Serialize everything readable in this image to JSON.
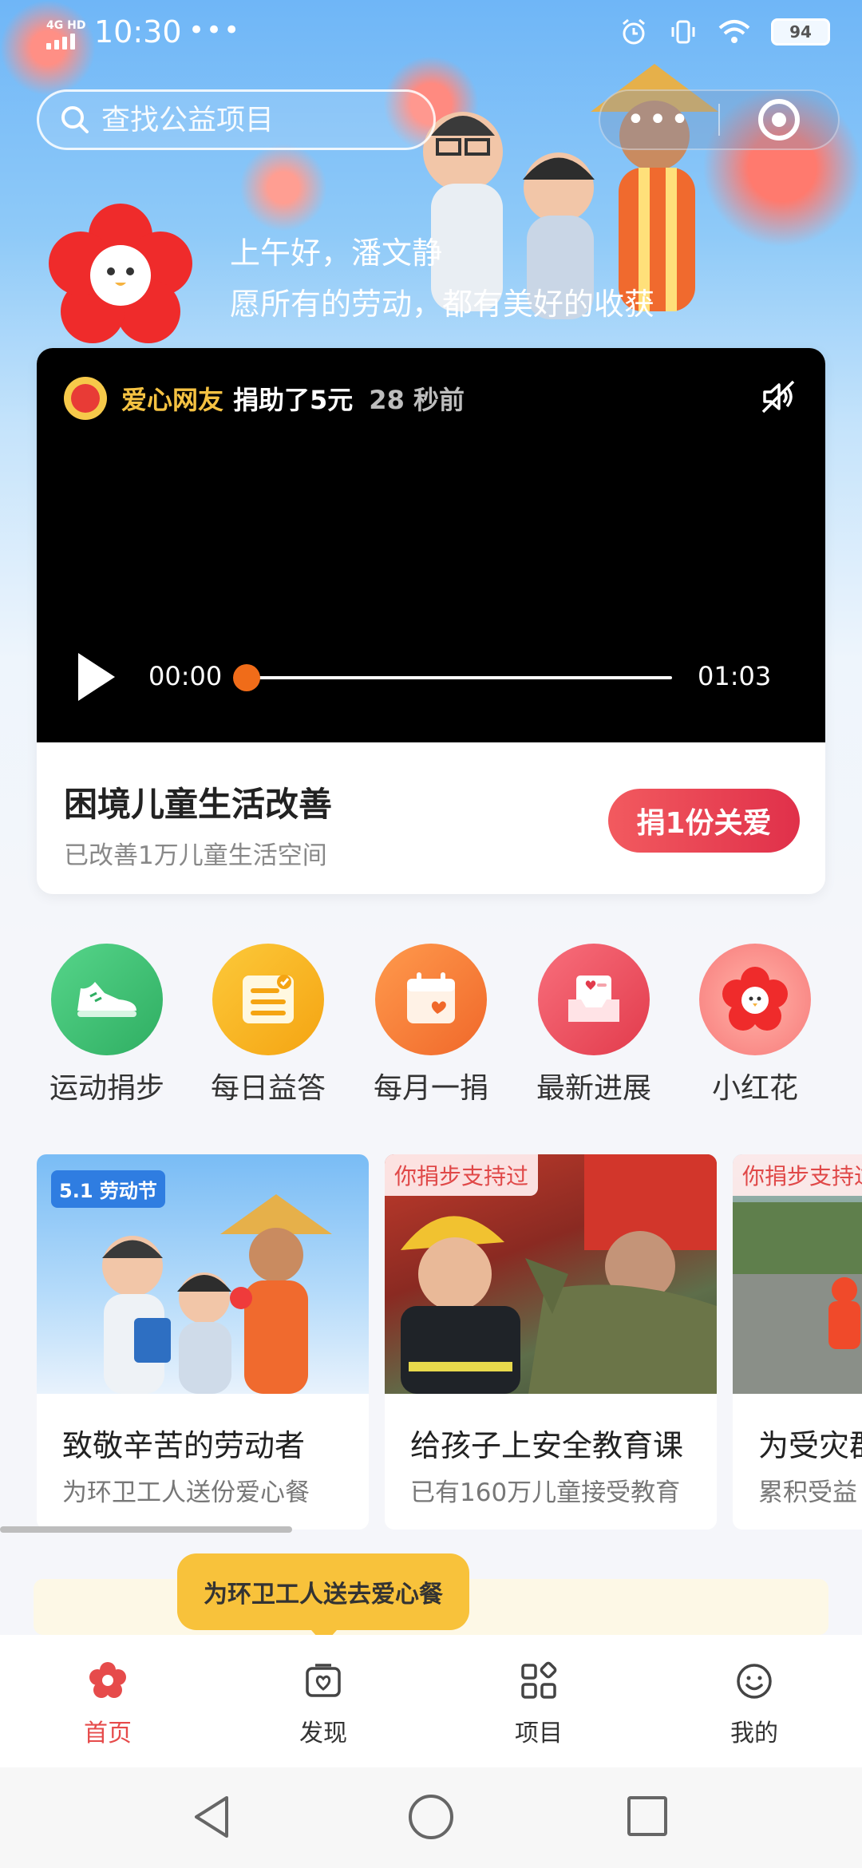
{
  "status_bar": {
    "network": "4G HD",
    "time": "10:30",
    "dots": "•••",
    "battery": "94"
  },
  "search": {
    "placeholder": "查找公益项目"
  },
  "capsule": {
    "more": "•••"
  },
  "greeting": {
    "line1": "上午好，潘文静",
    "line2": "愿所有的劳动，都有美好的收获"
  },
  "video_card": {
    "donor_name": "爱心网友",
    "donor_action": "捐助了5元",
    "donor_time": "28 秒前",
    "current_time": "00:00",
    "total_time": "01:03",
    "progress": 0,
    "project_title": "困境儿童生活改善",
    "project_subtitle": "已改善1万儿童生活空间",
    "donate_label": "捐1份关爱"
  },
  "quick_entries": [
    {
      "label": "运动捐步",
      "icon": "sneaker-icon",
      "color": "#3fbf72"
    },
    {
      "label": "每日益答",
      "icon": "quiz-card-icon",
      "color": "#f9b21f"
    },
    {
      "label": "每月一捐",
      "icon": "calendar-heart-icon",
      "color": "#f6813a"
    },
    {
      "label": "最新进展",
      "icon": "inbox-heart-icon",
      "color": "#eb4b5a"
    },
    {
      "label": "小红花",
      "icon": "red-flower-icon",
      "color": "#f87a7a"
    }
  ],
  "features": [
    {
      "tag": "",
      "badge": "5.1 劳动节",
      "title": "致敬辛苦的劳动者",
      "subtitle": "为环卫工人送份爱心餐"
    },
    {
      "tag": "你捐步支持过",
      "title": "给孩子上安全教育课",
      "subtitle": "已有160万儿童接受教育"
    },
    {
      "tag": "你捐步支持过",
      "title": "为受灾群众",
      "subtitle": "累积受益"
    }
  ],
  "tooltip": "为环卫工人送去爱心餐",
  "tabs": [
    {
      "label": "首页",
      "icon": "flower-home-icon",
      "active": true
    },
    {
      "label": "发现",
      "icon": "discover-icon",
      "active": false
    },
    {
      "label": "项目",
      "icon": "grid-icon",
      "active": false
    },
    {
      "label": "我的",
      "icon": "smile-icon",
      "active": false
    }
  ],
  "colors": {
    "accent": "#e64b4b",
    "donate_start": "#f25a5f",
    "donate_end": "#e0304a",
    "progress_knob": "#f06c19",
    "tooltip": "#f8c23b",
    "donor_name": "#f5c242"
  }
}
